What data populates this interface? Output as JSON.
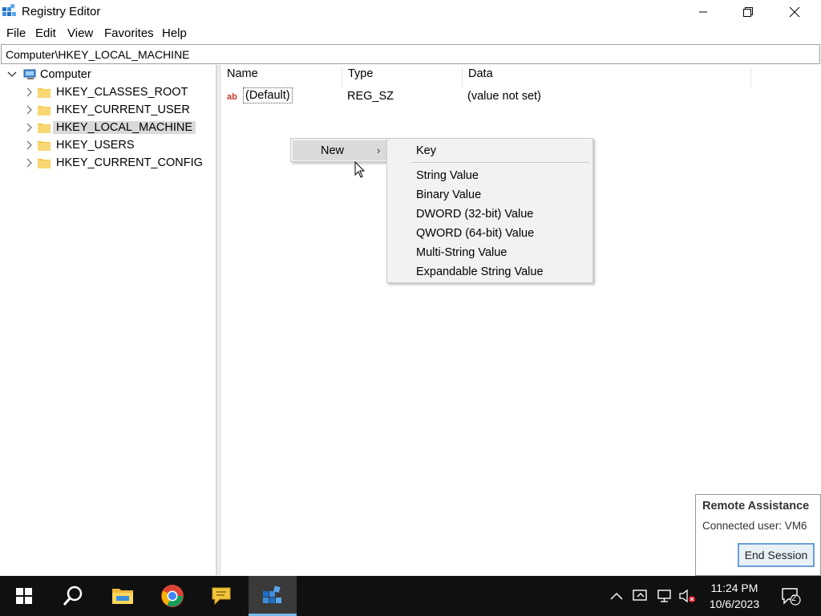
{
  "window": {
    "title": "Registry Editor",
    "icon": "registry-icon"
  },
  "menu": [
    "File",
    "Edit",
    "View",
    "Favorites",
    "Help"
  ],
  "address": "Computer\\HKEY_LOCAL_MACHINE",
  "tree": {
    "root": "Computer",
    "items": [
      {
        "label": "HKEY_CLASSES_ROOT",
        "selected": false
      },
      {
        "label": "HKEY_CURRENT_USER",
        "selected": false
      },
      {
        "label": "HKEY_LOCAL_MACHINE",
        "selected": true
      },
      {
        "label": "HKEY_USERS",
        "selected": false
      },
      {
        "label": "HKEY_CURRENT_CONFIG",
        "selected": false
      }
    ]
  },
  "values": {
    "columns": [
      "Name",
      "Type",
      "Data"
    ],
    "rows": [
      {
        "name": "(Default)",
        "type": "REG_SZ",
        "data": "(value not set)"
      }
    ]
  },
  "context_menu": {
    "new_label": "New",
    "submenu": {
      "key": "Key",
      "items": [
        "String Value",
        "Binary Value",
        "DWORD (32-bit) Value",
        "QWORD (64-bit) Value",
        "Multi-String Value",
        "Expandable String Value"
      ]
    }
  },
  "remote_assistance": {
    "title": "Remote Assistance",
    "connected_user": "Connected user: VM6",
    "end_button": "End Session"
  },
  "taskbar": {
    "apps": [
      "start-icon",
      "search-icon",
      "file-explorer-icon",
      "chrome-icon",
      "chat-icon",
      "registry-icon"
    ],
    "time": "11:24 PM",
    "date": "10/6/2023",
    "notification_count": "2",
    "accent": "#76b9ed"
  }
}
